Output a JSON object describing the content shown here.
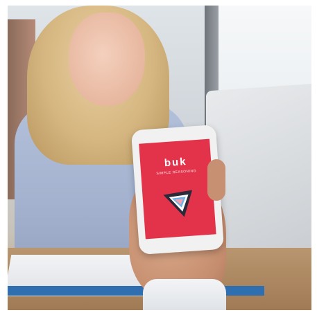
{
  "phone_screen": {
    "logo_text": "buk",
    "logo_subtitle": "SIMPLE REASONING",
    "background_color": "#e3334a",
    "logo_mark": "triangle-logo-icon"
  }
}
